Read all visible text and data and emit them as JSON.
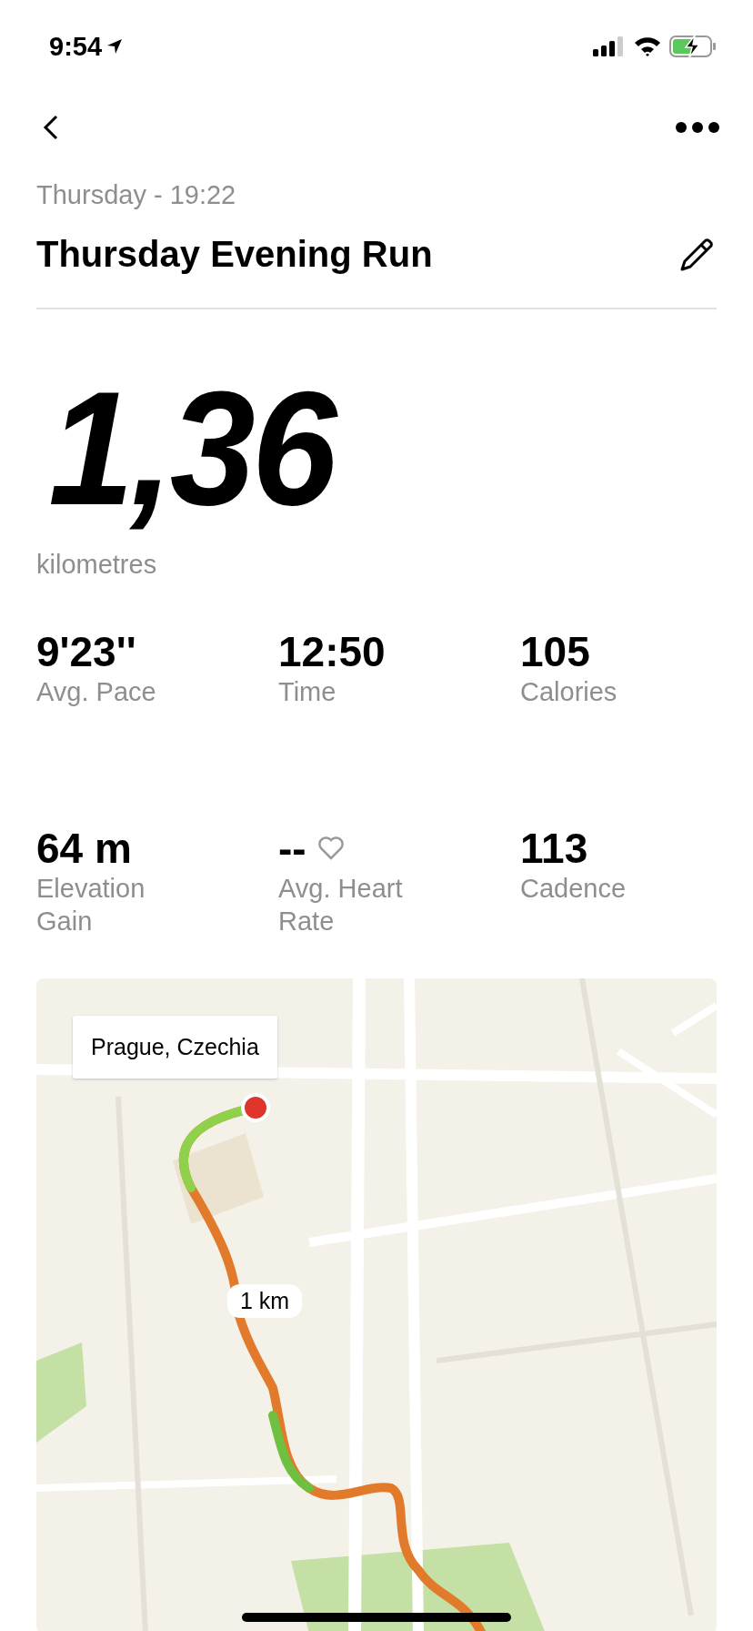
{
  "status_bar": {
    "time": "9:54"
  },
  "header": {
    "date": "Thursday - 19:22",
    "title": "Thursday Evening Run"
  },
  "distance": {
    "value": "1,36",
    "unit": "kilometres"
  },
  "stats": [
    {
      "kind": "plain",
      "value": "9'23''",
      "label": "Avg. Pace"
    },
    {
      "kind": "plain",
      "value": "12:50",
      "label": "Time"
    },
    {
      "kind": "plain",
      "value": "105",
      "label": "Calories"
    },
    {
      "kind": "plain",
      "value": "64 m",
      "label": "Elevation Gain"
    },
    {
      "kind": "heart",
      "value": "--",
      "label": "Avg. Heart Rate"
    },
    {
      "kind": "plain",
      "value": "113",
      "label": "Cadence"
    }
  ],
  "map": {
    "place_label": "Prague, Czechia",
    "marker_label": "1 km"
  }
}
